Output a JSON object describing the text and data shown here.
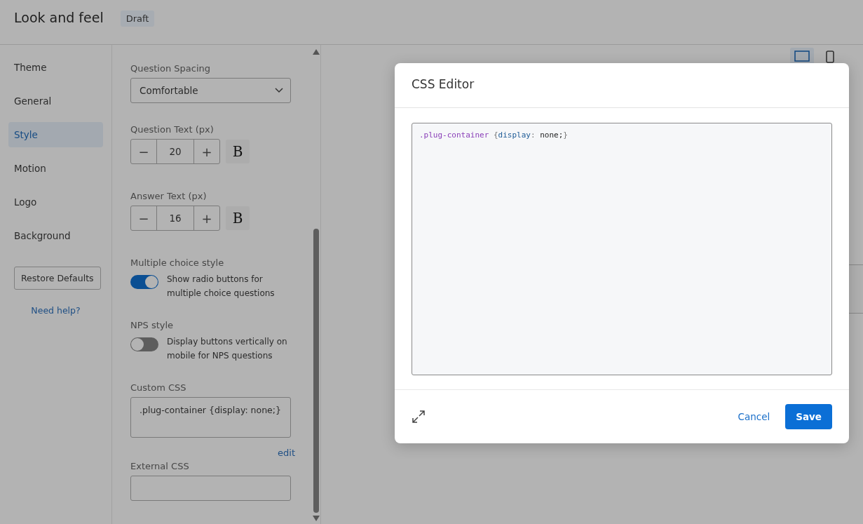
{
  "header": {
    "title": "Look and feel",
    "badge": "Draft"
  },
  "nav": {
    "items": [
      {
        "label": "Theme",
        "selected": false
      },
      {
        "label": "General",
        "selected": false
      },
      {
        "label": "Style",
        "selected": true
      },
      {
        "label": "Motion",
        "selected": false
      },
      {
        "label": "Logo",
        "selected": false
      },
      {
        "label": "Background",
        "selected": false
      }
    ],
    "restore_button": "Restore Defaults",
    "help_link": "Need help?"
  },
  "settings": {
    "question_spacing": {
      "label": "Question Spacing",
      "value": "Comfortable"
    },
    "steppers": [
      {
        "label": "Question Text (px)",
        "value": "20",
        "minus": "−",
        "plus": "+",
        "bold": "B"
      },
      {
        "label": "Answer Text (px)",
        "value": "16",
        "minus": "−",
        "plus": "+",
        "bold": "B"
      }
    ],
    "toggles": [
      {
        "label": "Multiple choice style",
        "text": "Show radio buttons for multiple choice questions",
        "on": true
      },
      {
        "label": "NPS style",
        "text": "Display buttons vertically on mobile for NPS questions",
        "on": false
      }
    ],
    "custom_css": {
      "label": "Custom CSS",
      "value": ".plug-container {display: none;}",
      "edit_link": "edit"
    },
    "external_css": {
      "label": "External CSS"
    }
  },
  "preview": {
    "devices": [
      {
        "kind": "desktop",
        "selected": true
      },
      {
        "kind": "mobile",
        "selected": false
      }
    ]
  },
  "modal": {
    "title": "CSS Editor",
    "code_tokens": [
      {
        "kind": "selector",
        "text": ".plug-container"
      },
      {
        "kind": "punct",
        "text": " {"
      },
      {
        "kind": "property",
        "text": "display"
      },
      {
        "kind": "punct",
        "text": ":"
      },
      {
        "kind": "value",
        "text": " none;"
      },
      {
        "kind": "punct",
        "text": "}"
      }
    ],
    "cancel": "Cancel",
    "save": "Save"
  }
}
